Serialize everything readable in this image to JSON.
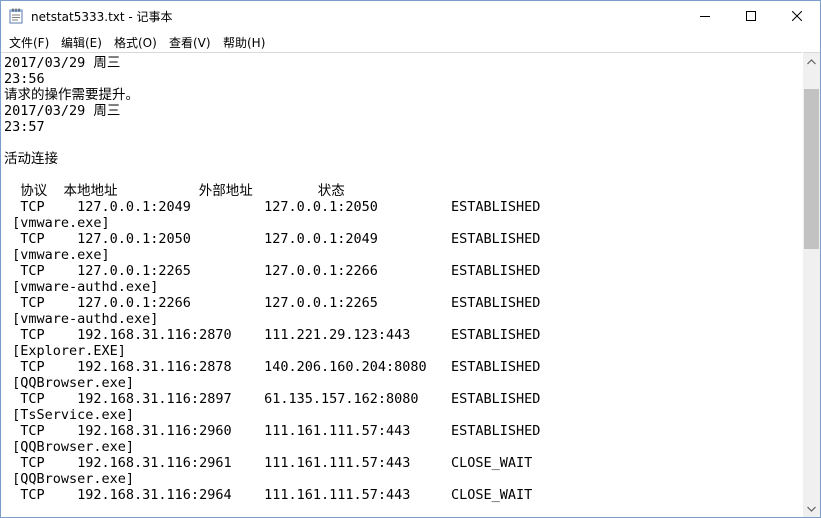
{
  "window": {
    "title": "netstat5333.txt - 记事本"
  },
  "menu": [
    {
      "label": "文件(F)"
    },
    {
      "label": "编辑(E)"
    },
    {
      "label": "格式(O)"
    },
    {
      "label": "查看(V)"
    },
    {
      "label": "帮助(H)"
    }
  ],
  "document": {
    "lines": [
      "2017/03/29 周三",
      "23:56",
      "请求的操作需要提升。",
      "2017/03/29 周三",
      "23:57",
      "",
      "活动连接",
      "",
      "  协议  本地地址          外部地址        状态",
      "  TCP    127.0.0.1:2049         127.0.0.1:2050         ESTABLISHED",
      " [vmware.exe]",
      "  TCP    127.0.0.1:2050         127.0.0.1:2049         ESTABLISHED",
      " [vmware.exe]",
      "  TCP    127.0.0.1:2265         127.0.0.1:2266         ESTABLISHED",
      " [vmware-authd.exe]",
      "  TCP    127.0.0.1:2266         127.0.0.1:2265         ESTABLISHED",
      " [vmware-authd.exe]",
      "  TCP    192.168.31.116:2870    111.221.29.123:443     ESTABLISHED",
      " [Explorer.EXE]",
      "  TCP    192.168.31.116:2878    140.206.160.204:8080   ESTABLISHED",
      " [QQBrowser.exe]",
      "  TCP    192.168.31.116:2897    61.135.157.162:8080    ESTABLISHED",
      " [TsService.exe]",
      "  TCP    192.168.31.116:2960    111.161.111.57:443     ESTABLISHED",
      " [QQBrowser.exe]",
      "  TCP    192.168.31.116:2961    111.161.111.57:443     CLOSE_WAIT",
      " [QQBrowser.exe]",
      "  TCP    192.168.31.116:2964    111.161.111.57:443     CLOSE_WAIT"
    ]
  },
  "icons": {
    "app": "notepad-icon",
    "minimize": "minimize-icon",
    "maximize": "maximize-icon",
    "close": "close-icon",
    "scroll_up": "scroll-up-arrow-icon",
    "scroll_down": "scroll-down-arrow-icon"
  },
  "colors": {
    "window_border": "#7a9ec9",
    "scrollbar_track": "#f0f0f0",
    "scrollbar_thumb": "#c2c2c2"
  }
}
